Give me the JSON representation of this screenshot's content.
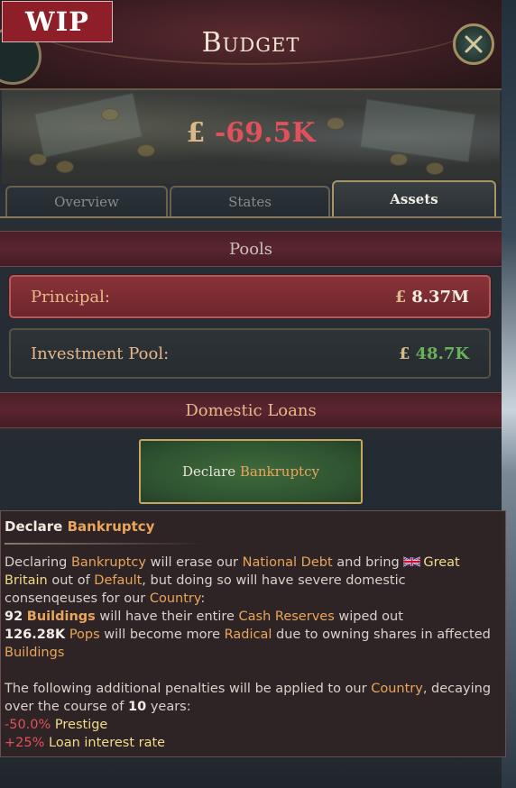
{
  "badge": "WIP",
  "window": {
    "title": "Budget"
  },
  "balance": {
    "currency": "£",
    "value": "-69.5K"
  },
  "tabs": [
    {
      "label": "Overview",
      "active": false
    },
    {
      "label": "States",
      "active": false
    },
    {
      "label": "Assets",
      "active": true
    }
  ],
  "pools": {
    "header": "Pools",
    "principal": {
      "label": "Principal:",
      "currency": "£",
      "value": "8.37M"
    },
    "investment": {
      "label": "Investment Pool:",
      "currency": "£",
      "value": "48.7K"
    }
  },
  "loans": {
    "header": "Domestic Loans",
    "button_prefix": "Declare",
    "button_highlight": "Bankruptcy"
  },
  "tooltip": {
    "title_prefix": "Declare",
    "title_highlight": "Bankruptcy",
    "p1": {
      "t1": "Declaring",
      "h1": "Bankruptcy",
      "t2": "will erase our",
      "h2": "National Debt",
      "t3": "and bring",
      "country": "Great Britain",
      "t4": "out of",
      "h3": "Default",
      "t5": ", but doing so will have severe domestic consenqeuses for our",
      "h4": "Country",
      "t6": ":"
    },
    "l1": {
      "num": "92",
      "h": "Buildings",
      "t1": "will have their entire",
      "h2": "Cash Reserves",
      "t2": "wiped out"
    },
    "l2": {
      "num": "126.28K",
      "h": "Pops",
      "t1": "will become more",
      "h2": "Radical",
      "t2": "due to owning shares in affected",
      "h3": "Buildings"
    },
    "p2": {
      "t1": "The following additional penalties will be applied to our",
      "h1": "Country",
      "t2": ", decaying over the course of",
      "years": "10",
      "t3": "years:"
    },
    "penalties": [
      {
        "value": "-50.0%",
        "label": "Prestige"
      },
      {
        "value": "+25%",
        "label": "Loan interest rate"
      }
    ]
  },
  "colors": {
    "accent_orange": "#e9a55c",
    "negative_red": "#e0515b",
    "positive_green": "#69b15a",
    "gold": "#c8a65a"
  }
}
